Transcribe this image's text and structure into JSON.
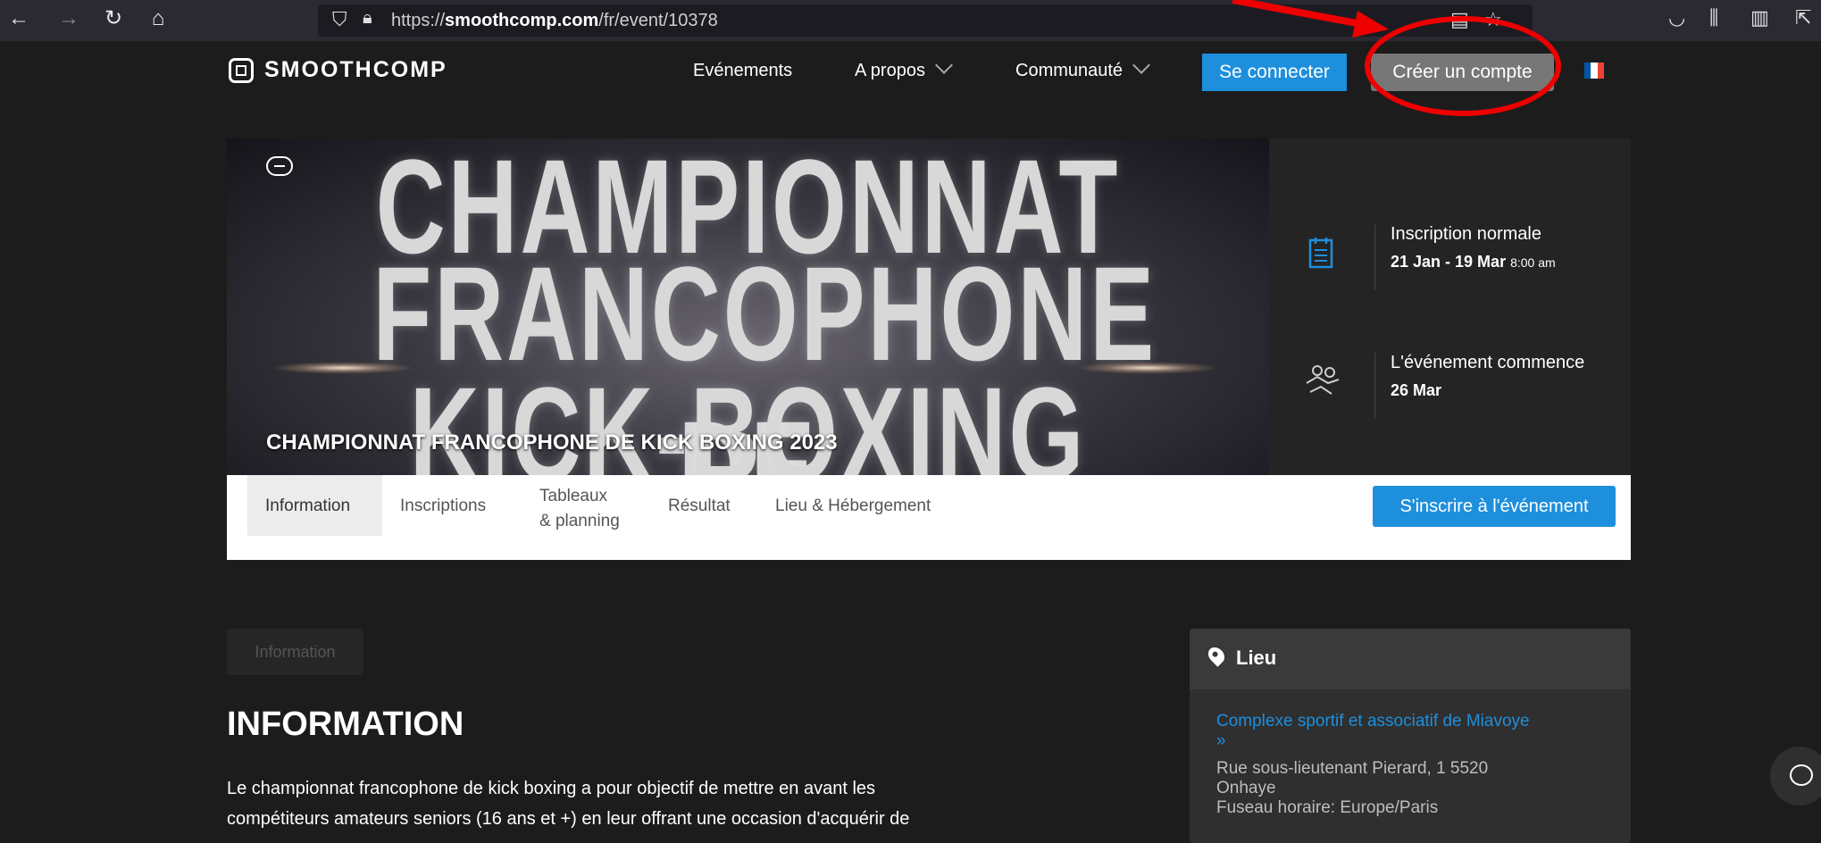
{
  "browser": {
    "url_prefix": "https://",
    "url_domain": "smoothcomp.com",
    "url_path": "/fr/event/10378"
  },
  "nav": {
    "logo": "SMOOTHCOMP",
    "events": "Evénements",
    "about": "A propos",
    "community": "Communauté",
    "login": "Se connecter",
    "signup": "Créer un compte"
  },
  "banner": {
    "big_line1": "CHAMPIONNAT",
    "big_line2": "FRANCOPHONE DE",
    "big_line3": "KICK-BOXING",
    "title": "CHAMPIONNAT FRANCOPHONE DE KICK BOXING 2023"
  },
  "info": {
    "reg_label": "Inscription normale",
    "reg_dates": "21 Jan - 19 Mar",
    "reg_time": "8:00 am",
    "start_label": "L'événement commence",
    "start_date": "26 Mar"
  },
  "tabs": {
    "information": "Information",
    "inscriptions": "Inscriptions",
    "tableaux_1": "Tableaux",
    "tableaux_2": "& planning",
    "resultat": "Résultat",
    "lieu": "Lieu & Hébergement",
    "register": "S'inscrire à l'événement"
  },
  "content": {
    "pill": "Information",
    "heading": "INFORMATION",
    "para_line1": "Le championnat francophone de kick boxing a pour objectif de mettre en avant les",
    "para_line2": "compétiteurs amateurs seniors (16 ans et +) en leur offrant une occasion d'acquérir de"
  },
  "lieu": {
    "title": "Lieu",
    "venue_link": "Complexe sportif et associatif de Miavoye",
    "link_arrow": "»",
    "addr1": "Rue sous-lieutenant Pierard, 1 5520",
    "addr2": "Onhaye",
    "timezone": "Fuseau horaire: Europe/Paris"
  },
  "colors": {
    "accent_blue": "#1e8fdc",
    "annotation_red": "#ee0000",
    "page_bg": "#1c1c1c"
  }
}
